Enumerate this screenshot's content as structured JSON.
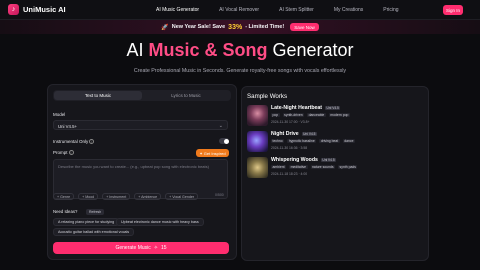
{
  "nav": {
    "brand": "UniMusic AI",
    "links": [
      "AI Music Generator",
      "AI Vocal Remover",
      "AI Stem Splitter",
      "My Creations",
      "Pricing"
    ],
    "signin": "Sign In"
  },
  "promo": {
    "text": "New Year Sale! Save",
    "percent": "33%",
    "suffix": "- Limited Time!",
    "button": "Save Now"
  },
  "hero": {
    "title_pre": "AI ",
    "title_accent": "Music & Song",
    "title_post": " Generator",
    "subtitle": "Create Professional Music in Seconds. Generate royalty-free songs with vocals effortlessly"
  },
  "form": {
    "tabs": [
      "Text to Music",
      "Lyrics to Music"
    ],
    "model_label": "Model",
    "model_value": "Uni V4.5+",
    "instrumental_label": "Instrumental Only",
    "prompt_label": "Prompt",
    "inspire_label": "Get Inspired",
    "prompt_placeholder": "Describe the music you want to create... (e.g., upbeat pop song with electronic beats)",
    "counter": "0/500",
    "chips": [
      "+ Genre",
      "+ Mood",
      "+ Instrument",
      "+ Ambience",
      "+ Vocal Gender"
    ],
    "ideas_label": "Need Ideas?",
    "refresh_label": "Refresh",
    "ideas": [
      "A relaxing piano piece for studying",
      "Upbeat electronic dance music with heavy bass",
      "Acoustic guitar ballad with emotional vocals"
    ],
    "generate_label": "Generate Music",
    "generate_cost": "15"
  },
  "sample": {
    "title": "Sample Works",
    "works": [
      {
        "title": "Late-Night Heartbeat",
        "badge": "Uni V4.5",
        "tags": [
          "pop",
          "synth-driven",
          "danceable",
          "modern pop"
        ],
        "meta": "2024-11-30 17:00  ·  V3.8+"
      },
      {
        "title": "Night Drive",
        "badge": "Uni V4.5",
        "tags": [
          "techno",
          "hypnotic bassline",
          "driving beat",
          "dance"
        ],
        "meta": "2024-11-30 16:36  ·  3:58"
      },
      {
        "title": "Whispering Woods",
        "badge": "Uni V4.5",
        "tags": [
          "ambient",
          "meditative",
          "nature sounds",
          "synth pads"
        ],
        "meta": "2024-11-18 18:23  ·  4:00"
      }
    ]
  },
  "colors": {
    "accent": "#ff2d6f",
    "orange": "#f07a1c",
    "background": "#0c0c0f"
  },
  "icons": {
    "logo": "music-note-icon",
    "promo": "rocket-icon",
    "chevron": "chevron-down-icon",
    "info": "info-icon",
    "inspire": "sparkle-icon",
    "generate": "wand-icon"
  }
}
